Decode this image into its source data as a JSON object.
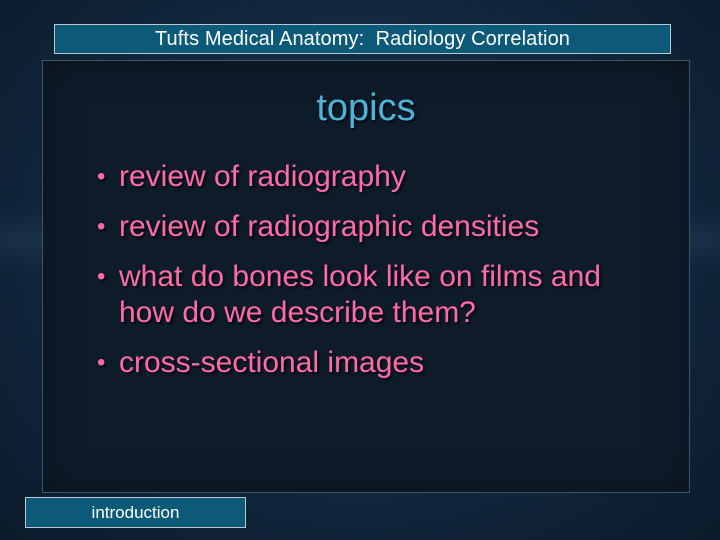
{
  "header": {
    "title": "Tufts Medical Anatomy:  Radiology Correlation"
  },
  "slide": {
    "title": "topics",
    "bullets": [
      "review of radiography",
      "review of radiographic densities",
      "what do bones look like on films and how do we describe them?",
      "cross-sectional images"
    ]
  },
  "footer": {
    "label": "introduction"
  },
  "colors": {
    "header_bg": "#0d5a78",
    "title_text": "#4fb3d9",
    "bullet_text": "#ff6aa8",
    "panel_bg": "#0e1c2a"
  }
}
